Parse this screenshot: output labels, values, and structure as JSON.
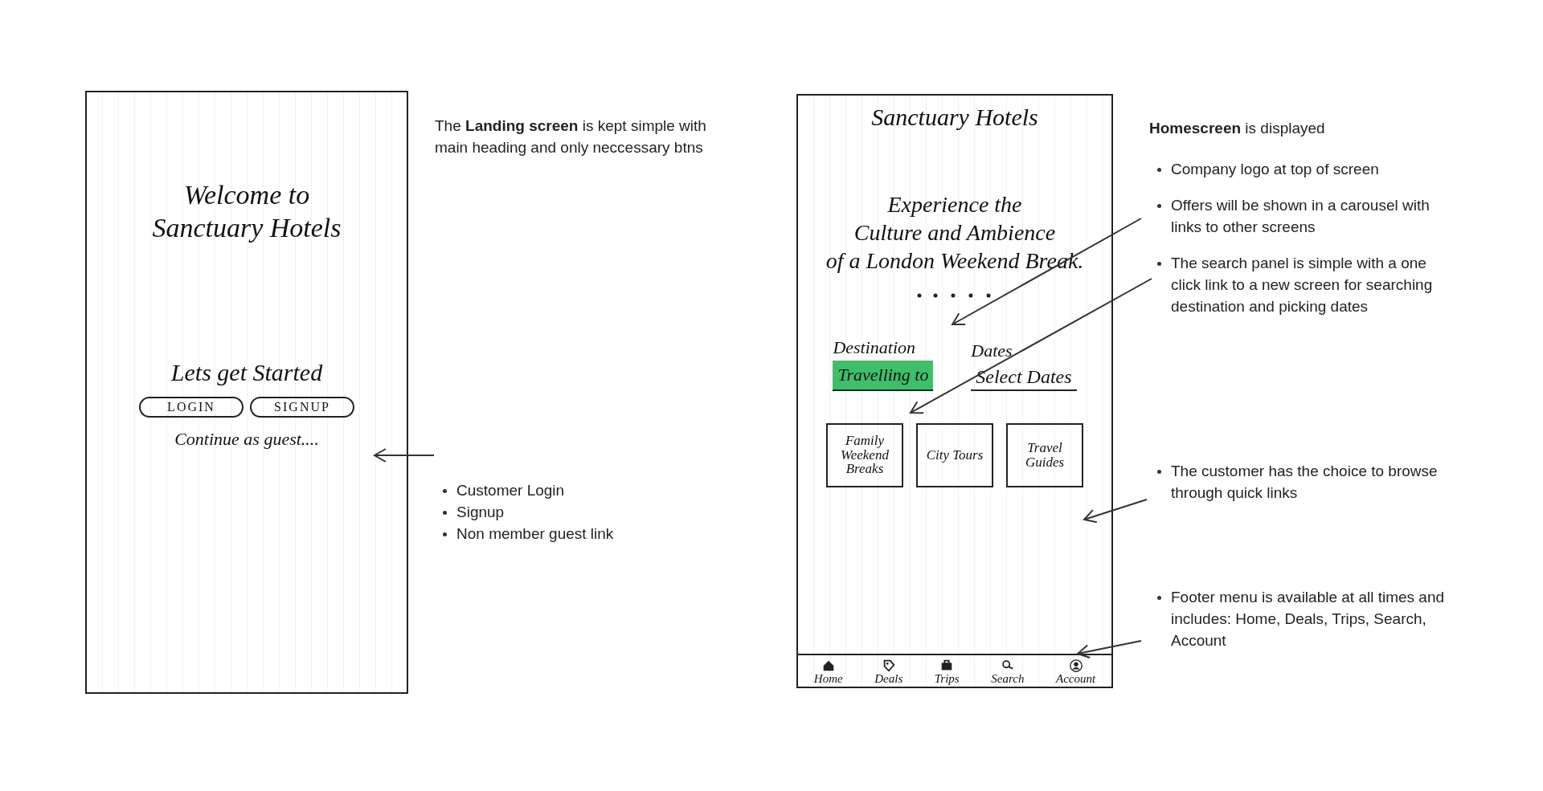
{
  "landing_screen": {
    "heading": [
      "Welcome to",
      "Sanctuary Hotels"
    ],
    "subheading": "Lets get Started",
    "buttons": [
      "LOGIN",
      "SIGNUP"
    ],
    "guest_link": "Continue as guest...."
  },
  "landing_note": {
    "text": "The **Landing screen** is kept simple with main heading and only neccessary btns",
    "bullets": [
      "Customer Login",
      "Signup",
      "Non member guest link"
    ]
  },
  "home_screen": {
    "logo": "Sanctuary Hotels",
    "offer_text": [
      "Experience the",
      "Culture and Ambience",
      "of a London Weekend Break."
    ],
    "search_fields": [
      {
        "label": "Destination",
        "value": "Travelling to",
        "highlighted": true
      },
      {
        "label": "Dates",
        "value": "Select Dates",
        "highlighted": false
      }
    ],
    "quick_links": [
      "Family Weekend Breaks",
      "City Tours",
      "Travel Guides"
    ],
    "footer_menu": [
      {
        "label": "Home",
        "kind": "home"
      },
      {
        "label": "Deals",
        "kind": "deals"
      },
      {
        "label": "Trips",
        "kind": "trips"
      },
      {
        "label": "Search",
        "kind": "search"
      },
      {
        "label": "Account",
        "kind": "account"
      }
    ]
  },
  "home_note": {
    "text": "**Homescreen** is displayed",
    "bullets": [
      "Company logo at top of screen",
      "Offers will be shown in a carousel with links to other screens",
      "The search panel is simple with a one click link to a new screen for searching destination and picking dates",
      "The customer has the choice to browse through quick links",
      "Footer menu is available at all times and includes: Home, Deals, Trips, Search, Account"
    ]
  }
}
